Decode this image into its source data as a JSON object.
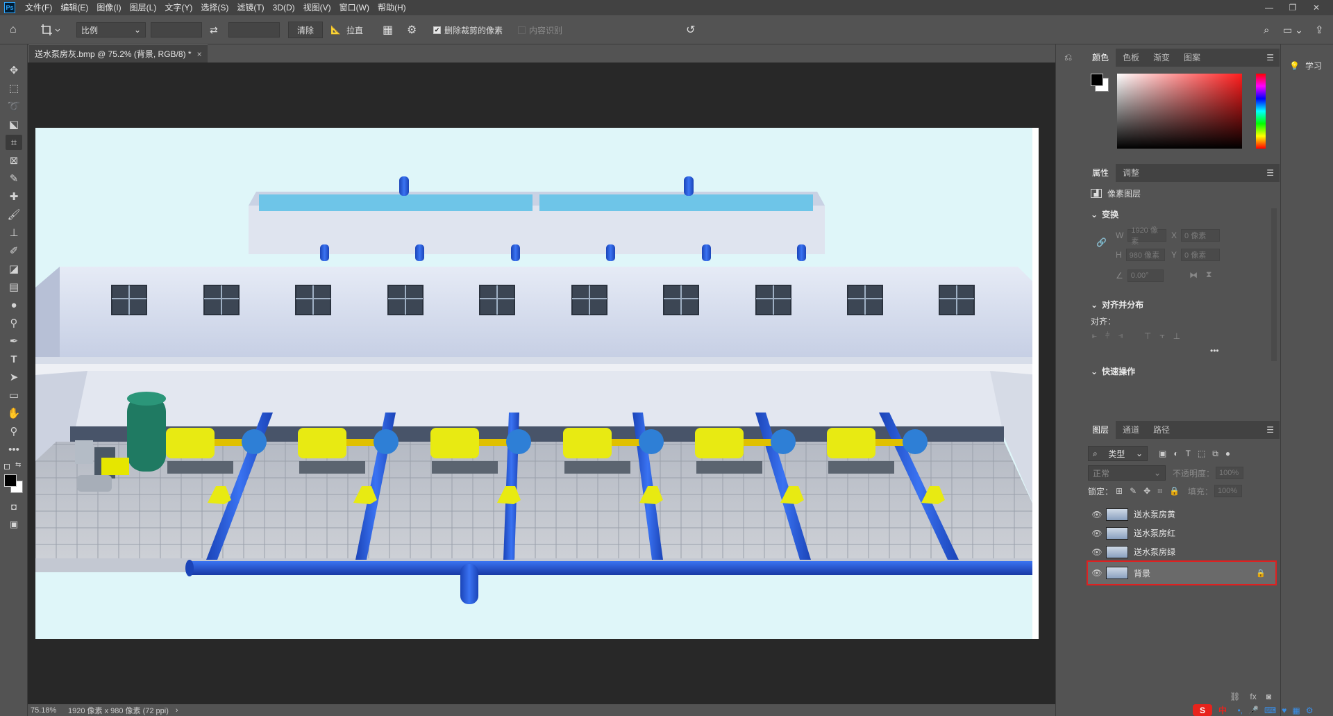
{
  "app": {
    "logo": "Ps"
  },
  "menu": [
    "文件(F)",
    "编辑(E)",
    "图像(I)",
    "图层(L)",
    "文字(Y)",
    "选择(S)",
    "滤镜(T)",
    "3D(D)",
    "视图(V)",
    "窗口(W)",
    "帮助(H)"
  ],
  "options": {
    "ratio_select": "比例",
    "clear_button": "清除",
    "straighten_label": "拉直",
    "delete_cropped_label": "删除裁剪的像素",
    "delete_cropped_checked": true,
    "content_aware_label": "内容识别",
    "content_aware_checked": false
  },
  "document": {
    "tab_title": "送水泵房灰.bmp @ 75.2% (背景, RGB/8) *",
    "close": "×"
  },
  "status": {
    "zoom": "75.18%",
    "info": "1920 像素 x 980 像素 (72 ppi)",
    "arrow": "›"
  },
  "color_panel": {
    "tabs": [
      "颜色",
      "色板",
      "渐变",
      "图案"
    ],
    "fg": "#000000",
    "bg": "#ffffff"
  },
  "properties_panel": {
    "tabs": [
      "属性",
      "调整"
    ],
    "layer_type": "像素图层",
    "transform_title": "变换",
    "w_label": "W",
    "w_value": "1920 像素",
    "h_label": "H",
    "h_value": "980 像素",
    "x_label": "X",
    "x_value": "0 像素",
    "y_label": "Y",
    "y_value": "0 像素",
    "angle_value": "0.00°",
    "align_title": "对齐并分布",
    "align_label": "对齐：",
    "more": "•••",
    "quick_title": "快速操作"
  },
  "layers_panel": {
    "tabs": [
      "图层",
      "通道",
      "路径"
    ],
    "filter_kind": "类型",
    "blend_mode": "正常",
    "opacity_label": "不透明度：",
    "opacity_value": "100%",
    "lock_label": "锁定：",
    "fill_label": "填充：",
    "fill_value": "100%",
    "layers": [
      {
        "name": "送水泵房黄",
        "visible": true,
        "locked": false
      },
      {
        "name": "送水泵房红",
        "visible": true,
        "locked": false
      },
      {
        "name": "送水泵房绿",
        "visible": true,
        "locked": false
      },
      {
        "name": "背景",
        "visible": true,
        "locked": true
      }
    ]
  },
  "learn_panel": {
    "label": "学习"
  },
  "ime": {
    "logo": "S",
    "lang": "中"
  }
}
